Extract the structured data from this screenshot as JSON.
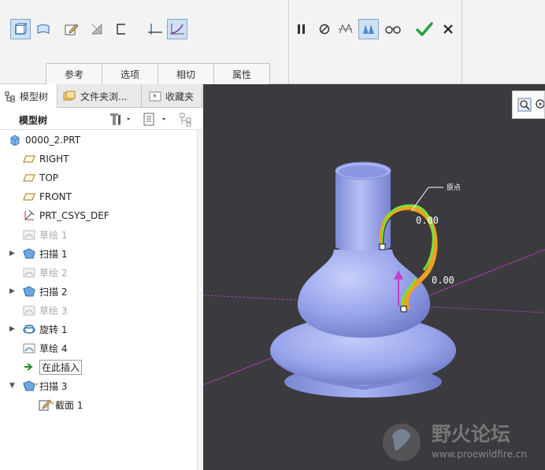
{
  "ribbon": {
    "dash_tabs": [
      "参考",
      "选项",
      "相切",
      "属性"
    ]
  },
  "navigator": {
    "tabs": [
      {
        "label": "模型树",
        "icon": "model-tree-icon"
      },
      {
        "label": "文件夹浏...",
        "icon": "folder-browser-icon"
      },
      {
        "label": "收藏夹",
        "icon": "favorites-icon"
      }
    ],
    "title": "模型树"
  },
  "tree": {
    "items": [
      {
        "label": "0000_2.PRT",
        "icon": "part-icon",
        "expand": "",
        "dim": false
      },
      {
        "label": "RIGHT",
        "icon": "datum-plane-icon",
        "expand": "",
        "dim": false
      },
      {
        "label": "TOP",
        "icon": "datum-plane-icon",
        "expand": "",
        "dim": false
      },
      {
        "label": "FRONT",
        "icon": "datum-plane-icon",
        "expand": "",
        "dim": false
      },
      {
        "label": "PRT_CSYS_DEF",
        "icon": "csys-icon",
        "expand": "",
        "dim": false
      },
      {
        "label": "草绘 1",
        "icon": "sketch-icon",
        "expand": "",
        "dim": true
      },
      {
        "label": "扫描 1",
        "icon": "sweep-icon",
        "expand": "▶",
        "dim": false
      },
      {
        "label": "草绘 2",
        "icon": "sketch-icon",
        "expand": "",
        "dim": true
      },
      {
        "label": "扫描 2",
        "icon": "sweep-icon",
        "expand": "▶",
        "dim": false
      },
      {
        "label": "草绘 3",
        "icon": "sketch-icon",
        "expand": "",
        "dim": true
      },
      {
        "label": "旋转 1",
        "icon": "revolve-icon",
        "expand": "▶",
        "dim": false
      },
      {
        "label": "草绘 4",
        "icon": "sketch-icon",
        "expand": "",
        "dim": false
      },
      {
        "label": "在此插入",
        "icon": "insert-here-icon",
        "expand": "",
        "dim": false
      },
      {
        "label": "扫描 3",
        "icon": "sweep-icon",
        "expand": "▼",
        "dim": false
      },
      {
        "label": "截面 1",
        "icon": "section-icon",
        "expand": "",
        "dim": false
      }
    ]
  },
  "viewport": {
    "annotations": {
      "origin_label": "原点",
      "dim1": "0.00",
      "dim2": "0.00"
    },
    "watermark": {
      "name": "野火论坛",
      "url": "www.proewildfire.cn"
    }
  },
  "colors": {
    "viewport_bg": "#3b3b3f",
    "model": "#9aa6ec",
    "trajectory_green": "#7ee03a",
    "trajectory_orange": "#f0a020",
    "datum_line": "#c040c8",
    "confirm": "#2ea043"
  }
}
